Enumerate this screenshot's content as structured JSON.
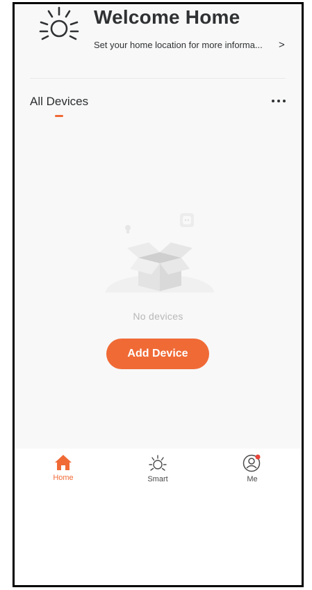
{
  "header": {
    "title": "Welcome Home",
    "subtitle": "Set your home location for more informa...",
    "chevron": ">",
    "icon": "sun-icon"
  },
  "devices": {
    "tab_label": "All Devices",
    "more_icon": "more-horizontal-icon",
    "empty_text": "No devices",
    "empty_icon": "empty-box-illustration",
    "add_button": "Add Device"
  },
  "tabbar": {
    "items": [
      {
        "label": "Home",
        "icon": "home-icon",
        "active": true
      },
      {
        "label": "Smart",
        "icon": "smart-sun-icon",
        "active": false
      },
      {
        "label": "Me",
        "icon": "profile-icon",
        "active": false,
        "badge": true
      }
    ]
  },
  "colors": {
    "accent": "#f06a36",
    "badge": "#e8443a",
    "text_primary": "#2f3133",
    "text_muted": "#b7b7b7",
    "background": "#f8f8f8"
  }
}
